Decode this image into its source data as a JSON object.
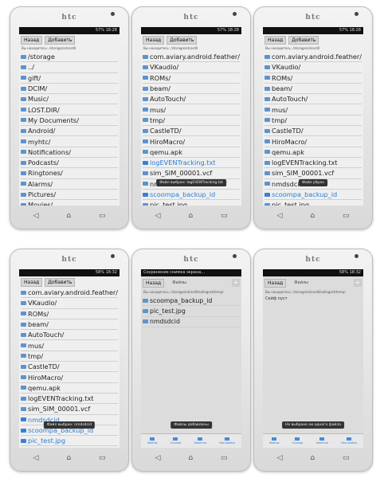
{
  "brand": "htc",
  "buttons": {
    "back": "Назад",
    "add": "Добавить"
  },
  "phones": [
    {
      "status_left": "",
      "status_right": "57% 18:28",
      "crumb": "Вы находитесь: /storage/sdcard0",
      "items": [
        "/storage",
        "../",
        "gift/",
        "DCIM/",
        "Music/",
        "LOST.DIR/",
        "My Documents/",
        "Android/",
        "myhtc/",
        "Notifications/",
        "Podcasts/",
        "Ringtones/",
        "Alarms/",
        "Pictures/",
        "Movies/"
      ],
      "selected": [],
      "toast": ""
    },
    {
      "status_left": "",
      "status_right": "57% 18:28",
      "crumb": "Вы находитесь: /storage/sdcard0",
      "items": [
        "com.aviary.android.feather/",
        "VKaudio/",
        "ROMs/",
        "beam/",
        "AutoTouch/",
        "mus/",
        "tmp/",
        "CastleTD/",
        "HiroMacro/",
        "qemu.apk",
        "logEVENTracking.txt",
        "sim_SIM_00001.vcf",
        "nmdsdcid",
        "scoompa_backup_id",
        "pic_test.jpg"
      ],
      "selected": [
        10,
        13
      ],
      "toast": "Файл выбран: logEVENTracking.txt"
    },
    {
      "status_left": "",
      "status_right": "57% 18:28",
      "crumb": "Вы находитесь: /storage/sdcard0",
      "items": [
        "com.aviary.android.feather/",
        "VKaudio/",
        "ROMs/",
        "beam/",
        "AutoTouch/",
        "mus/",
        "tmp/",
        "CastleTD/",
        "HiroMacro/",
        "qemu.apk",
        "logEVENTracking.txt",
        "sim_SIM_00001.vcf",
        "nmdsdcid",
        "scoompa_backup_id",
        "pic_test.jpg"
      ],
      "selected": [
        13
      ],
      "toast": "Файл убран"
    },
    {
      "status_left": "",
      "status_right": "58% 18:32",
      "crumb": "",
      "items": [
        "com.aviary.android.feather/",
        "VKaudio/",
        "ROMs/",
        "beam/",
        "AutoTouch/",
        "mus/",
        "tmp/",
        "CastleTD/",
        "HiroMacro/",
        "qemu.apk",
        "logEVENTracking.txt",
        "sim_SIM_00001.vcf",
        "nmdsdcid",
        "scoompa_backup_id",
        "pic_test.jpg"
      ],
      "selected": [
        12,
        13,
        14
      ],
      "toast": "Файл выбран: nmdsdcid"
    }
  ],
  "phone5": {
    "status_left": "Сохранение снимка экрана...",
    "header_title": "Файлы",
    "crumb": "Вы находитесь: /storage/sdcard0/sallegest/temp/",
    "items": [
      "scoompa_backup_id",
      "pic_test.jpg",
      "nmdsdcid"
    ],
    "toast": "Файлы добавлены",
    "tabs": [
      "Файлы",
      "Ссылки",
      "Заметки",
      "Настройки"
    ]
  },
  "phone6": {
    "status_right": "58% 18:32",
    "header_title": "Файлы",
    "crumb": "Вы находитесь: /storage/sdcard0/sallegest/temp/",
    "empty_text": "Сейф пуст",
    "toast": "Не выбрано ни одного файла",
    "tabs": [
      "Файлы",
      "Ссылки",
      "Заметки",
      "Настройки"
    ]
  },
  "nav_icons": [
    "back-icon",
    "home-icon",
    "recent-apps-icon"
  ]
}
